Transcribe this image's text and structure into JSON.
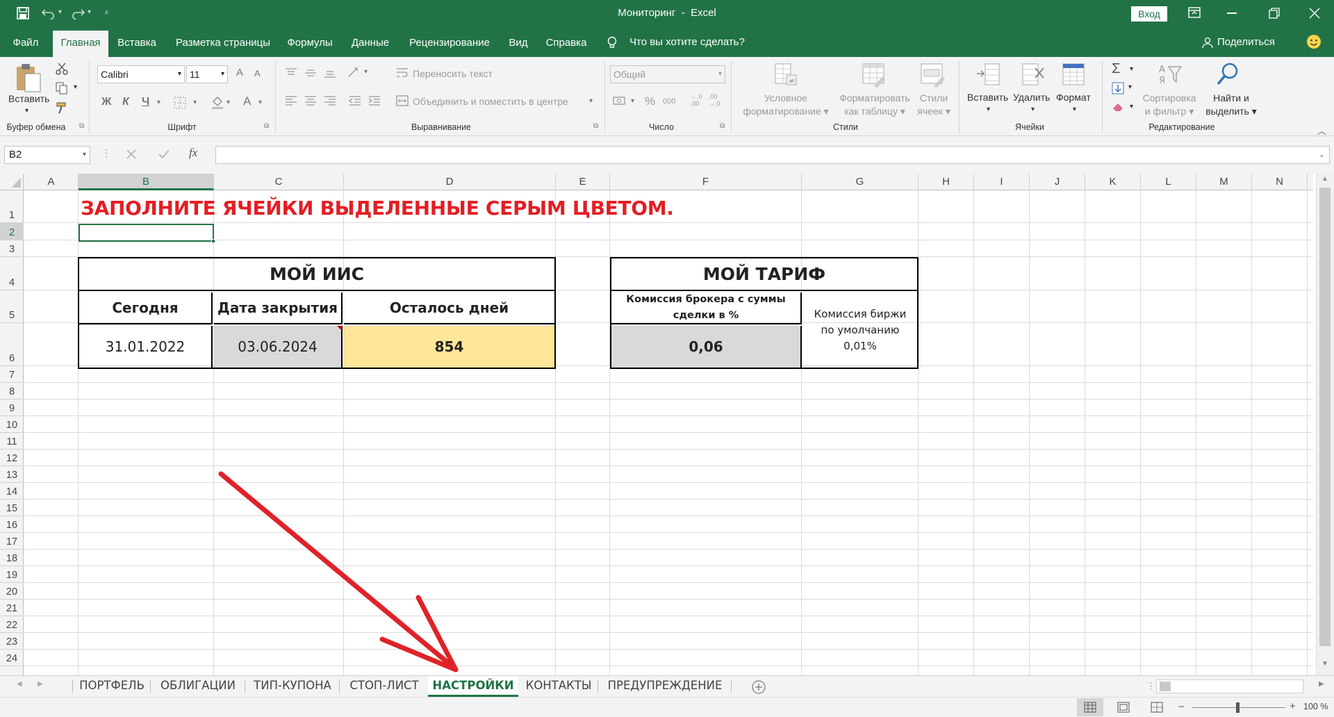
{
  "app": {
    "window_title": "Мониторинг  -  Excel",
    "signin_label": "Вход",
    "share_label": "Поделиться"
  },
  "ribbon_tabs": [
    "Файл",
    "Главная",
    "Вставка",
    "Разметка страницы",
    "Формулы",
    "Данные",
    "Рецензирование",
    "Вид",
    "Справка"
  ],
  "tell_me": "Что вы хотите сделать?",
  "ribbon": {
    "paste_label": "Вставить",
    "font_name": "Calibri",
    "font_size": "11",
    "bold": "Ж",
    "italic": "К",
    "underline": "Ч",
    "font_grow": "A",
    "font_shrink": "A",
    "font_color_letter": "A",
    "wrap_text": "Переносить текст",
    "merge_center": "Объединить и поместить в центре",
    "number_format": "Общий",
    "percent": "%",
    "thousands": "000",
    "inc_decimal": "←,0 ,00",
    "dec_decimal": ",00 →,0",
    "cond_format": [
      "Условное",
      "форматирование"
    ],
    "format_table": [
      "Форматировать",
      "как таблицу"
    ],
    "cell_styles": [
      "Стили",
      "ячеек"
    ],
    "insert_label": "Вставить",
    "delete_label": "Удалить",
    "format_label": "Формат",
    "sort_filter": [
      "Сортировка",
      "и фильтр"
    ],
    "find_select": [
      "Найти и",
      "выделить"
    ],
    "groups": [
      "Буфер обмена",
      "Шрифт",
      "Выравнивание",
      "Число",
      "Стили",
      "Ячейки",
      "Редактирование"
    ]
  },
  "formula_bar": {
    "name_box": "B2",
    "fx": "fx",
    "value": ""
  },
  "columns": [
    "A",
    "B",
    "C",
    "D",
    "E",
    "F",
    "G",
    "H",
    "I",
    "J",
    "K",
    "L",
    "M",
    "N"
  ],
  "selected_column": "B",
  "rows": [
    "1",
    "2",
    "3",
    "4",
    "5",
    "6",
    "7",
    "8",
    "9",
    "10",
    "11",
    "12",
    "13",
    "14",
    "15",
    "16",
    "17",
    "18",
    "19",
    "20",
    "21",
    "22",
    "23",
    "24"
  ],
  "selected_row": "2",
  "sheet": {
    "heading": "ЗАПОЛНИТЕ ЯЧЕЙКИ ВЫДЕЛЕННЫЕ СЕРЫМ ЦВЕТОМ.",
    "iis": {
      "title": "МОЙ ИИС",
      "col1_header": "Сегодня",
      "col2_header": "Дата закрытия",
      "col3_header": "Осталось дней",
      "today": "31.01.2022",
      "close_date": "03.06.2024",
      "days_left": "854"
    },
    "tariff": {
      "title": "МОЙ ТАРИФ",
      "broker_header": "Комиссия брокера с суммы сделки в %",
      "exchange_header": "Комиссия биржи по умолчанию 0,01%",
      "broker_value": "0,06"
    }
  },
  "sheet_tabs": [
    "ПОРТФЕЛЬ",
    "ОБЛИГАЦИИ",
    "ТИП-КУПОНА",
    "СТОП-ЛИСТ",
    "НАСТРОЙКИ",
    "КОНТАКТЫ",
    "ПРЕДУПРЕЖДЕНИЕ"
  ],
  "active_sheet": "НАСТРОЙКИ",
  "status": {
    "zoom": "100 %"
  },
  "colors": {
    "excel_green": "#217346",
    "heading_red": "#e31e24",
    "input_gray": "#d9d9d9",
    "result_yellow": "#ffe699",
    "arrow_red": "#e02228"
  }
}
